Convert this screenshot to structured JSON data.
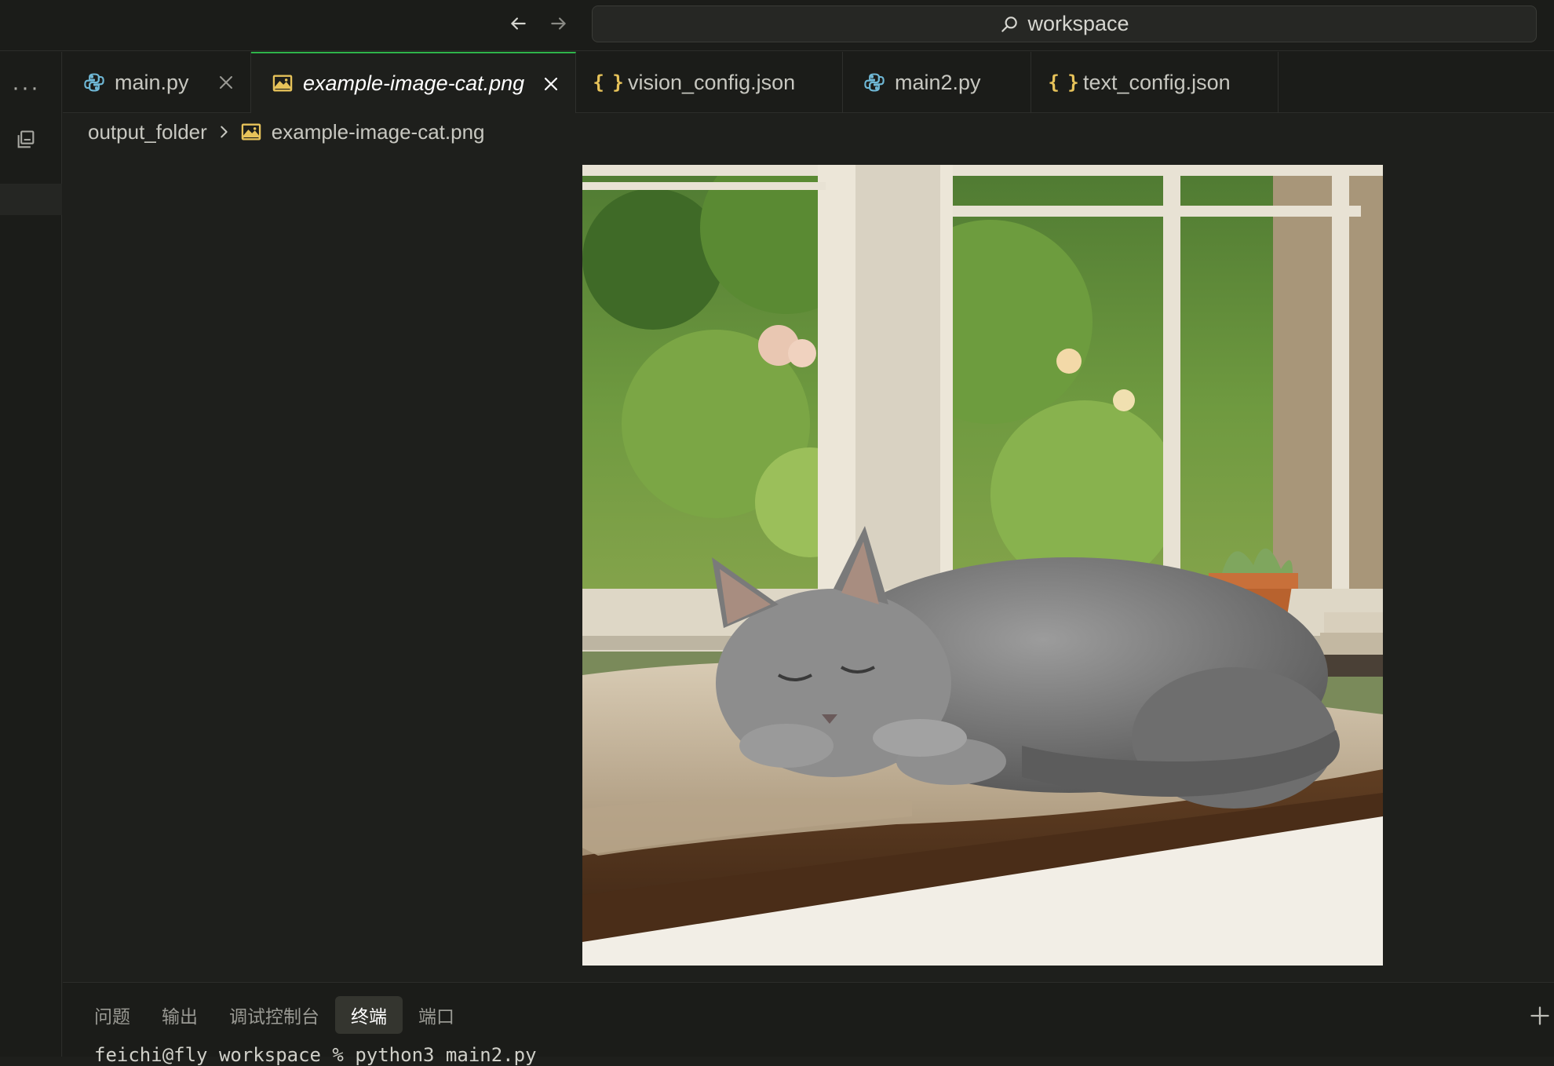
{
  "titlebar": {
    "search_text": "workspace"
  },
  "activitybar": {
    "more_label": "···"
  },
  "tabs": [
    {
      "label": "main.py",
      "icon": "python-icon",
      "active": false
    },
    {
      "label": "example-image-cat.png",
      "icon": "image-icon",
      "active": true
    },
    {
      "label": "vision_config.json",
      "icon": "json-braces-icon",
      "active": false
    },
    {
      "label": "main2.py",
      "icon": "python-icon",
      "active": false
    },
    {
      "label": "text_config.json",
      "icon": "json-braces-icon",
      "active": false
    }
  ],
  "tab_brace_glyph": "{ }",
  "breadcrumb": {
    "folder": "output_folder",
    "file": "example-image-cat.png"
  },
  "panel": {
    "tabs": [
      "问题",
      "输出",
      "调试控制台",
      "终端",
      "端口"
    ],
    "active_tab": "终端",
    "terminal_line": "feichi@fly workspace % python3 main2.py"
  },
  "colors": {
    "accent_tab_border": "#2fb44a",
    "json_icon": "#e7c35a",
    "image_icon": "#e7c35a",
    "python_icon": "#6fb8d6"
  }
}
